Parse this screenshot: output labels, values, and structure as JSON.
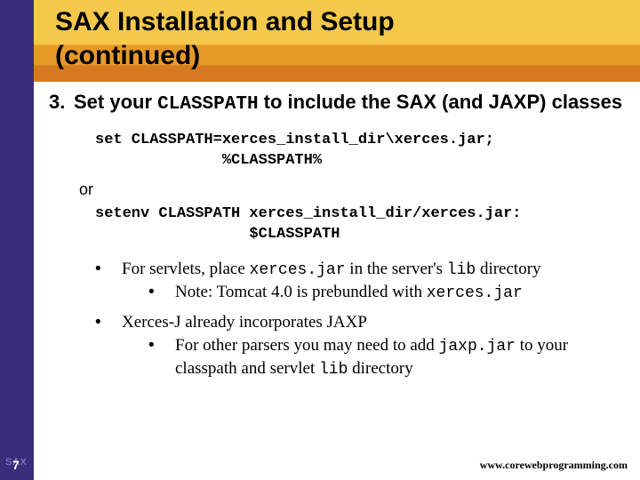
{
  "title_line1": "SAX Installation and Setup",
  "title_line2": "(continued)",
  "step": {
    "num": "3.",
    "text_pre": "Set your ",
    "text_mono": "CLASSPATH",
    "text_post": " to include the SAX (and JAXP) classes"
  },
  "code1_l1": "set CLASSPATH=xerces_install_dir\\xerces.jar;",
  "code1_l2": "              %CLASSPATH%",
  "or": "or",
  "code2_l1": "setenv CLASSPATH xerces_install_dir/xerces.jar:",
  "code2_l2": "                 $CLASSPATH",
  "b1": {
    "pre": "For servlets, place ",
    "m1": "xerces.jar",
    "mid": " in the server's ",
    "m2": "lib",
    "post": " directory"
  },
  "b1a": {
    "pre": "Note: Tomcat 4.0 is prebundled with ",
    "m1": "xerces.jar"
  },
  "b2": "Xerces-J already incorporates JAXP",
  "b2a": {
    "pre": "For other parsers you may need to add ",
    "m1": "jaxp.jar",
    "mid": " to your classpath and servlet ",
    "m2": "lib",
    "post": " directory"
  },
  "pagenum": "7",
  "sax_label": "SAX",
  "footer_url": "www.corewebprogramming.com"
}
